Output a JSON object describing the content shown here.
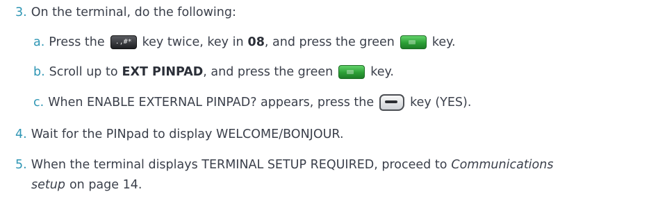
{
  "step3": {
    "num": "3.",
    "text": "On the terminal, do the following:",
    "a": {
      "label": "a.",
      "t1": "Press the",
      "t2": "key twice, key in",
      "bold": "08",
      "t3": ", and press the green",
      "t4": "key."
    },
    "b": {
      "label": "b.",
      "t1": "Scroll up to",
      "bold": "EXT PINPAD",
      "t2": ", and press the green",
      "t3": "key."
    },
    "c": {
      "label": "c.",
      "t1": "When ENABLE EXTERNAL PINPAD? appears, press the",
      "t2": "key (YES)."
    }
  },
  "step4": {
    "num": "4.",
    "text": "Wait for the PINpad to display WELCOME/BONJOUR."
  },
  "step5": {
    "num": "5.",
    "t1": "When the terminal displays TERMINAL SETUP REQUIRED, proceed to",
    "link": "Communications",
    "link2": "setup",
    "t2": "on page 14."
  },
  "keys": {
    "hash_key": ".,#*",
    "hash_icon": "hash-key-icon",
    "green_icon": "green-key-icon",
    "yes_icon": "yes-key-icon"
  },
  "colors": {
    "step_number": "#2f96b4",
    "text": "#3a3f4a",
    "green_key": "#2c9f36"
  }
}
